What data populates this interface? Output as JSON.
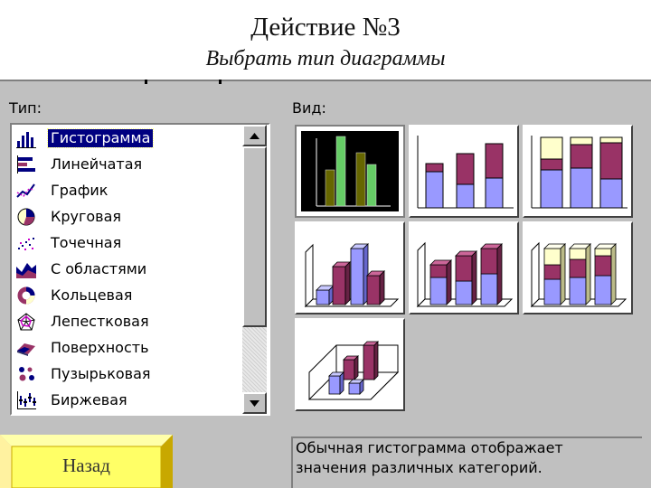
{
  "slide": {
    "title": "Действие №3",
    "subtitle": "Выбрать тип диаграммы"
  },
  "dialog": {
    "type_label": "Тип:",
    "view_label": "Вид:",
    "chart_types": [
      {
        "label": "Гистограмма",
        "icon": "column-chart-icon",
        "selected": true
      },
      {
        "label": "Линейчатая",
        "icon": "bar-chart-icon"
      },
      {
        "label": "График",
        "icon": "line-chart-icon"
      },
      {
        "label": "Круговая",
        "icon": "pie-chart-icon"
      },
      {
        "label": "Точечная",
        "icon": "scatter-chart-icon"
      },
      {
        "label": "С областями",
        "icon": "area-chart-icon"
      },
      {
        "label": "Кольцевая",
        "icon": "doughnut-chart-icon"
      },
      {
        "label": "Лепестковая",
        "icon": "radar-chart-icon"
      },
      {
        "label": "Поверхность",
        "icon": "surface-chart-icon"
      },
      {
        "label": "Пузырьковая",
        "icon": "bubble-chart-icon"
      },
      {
        "label": "Биржевая",
        "icon": "stock-chart-icon"
      }
    ],
    "subtypes": [
      {
        "name": "clustered-column",
        "selected": true
      },
      {
        "name": "stacked-column"
      },
      {
        "name": "100-percent-stacked-column"
      },
      {
        "name": "3d-clustered-column"
      },
      {
        "name": "3d-stacked-column"
      },
      {
        "name": "3d-100-percent-stacked-column"
      },
      {
        "name": "3d-column"
      }
    ],
    "description": "Обычная гистограмма отображает\nзначения различных категорий."
  },
  "back_button": {
    "label": "Назад"
  },
  "colors": {
    "dialog_bg": "#c0c0c0",
    "selection": "#000080",
    "series_blue": "#9999ff",
    "series_plum": "#993366",
    "series_cream": "#ffffcc",
    "thumb_green": "#66cc66",
    "thumb_olive": "#666600"
  }
}
